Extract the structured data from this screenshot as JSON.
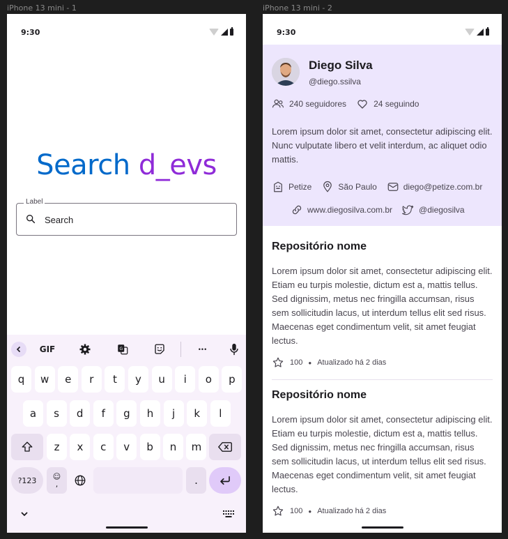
{
  "frames": {
    "frame1_label": "iPhone 13 mini - 1",
    "frame2_label": "iPhone 13 mini - 2"
  },
  "status": {
    "time": "9:30"
  },
  "search_screen": {
    "title_part1": "Search",
    "title_part2": "d_evs",
    "field_label": "Label",
    "field_placeholder": "Search"
  },
  "keyboard": {
    "gif_label": "GIF",
    "row1": [
      "q",
      "w",
      "e",
      "r",
      "t",
      "y",
      "u",
      "i",
      "o",
      "p"
    ],
    "row2": [
      "a",
      "s",
      "d",
      "f",
      "g",
      "h",
      "j",
      "k",
      "l"
    ],
    "row3": [
      "z",
      "x",
      "c",
      "v",
      "b",
      "n",
      "m"
    ],
    "numbers_key": "?123",
    "emoji_comma_top": "☺",
    "emoji_comma_bottom": ",",
    "period_key": ".",
    "toolbar_more": "•••"
  },
  "profile": {
    "name": "Diego Silva",
    "handle": "@diego.ssilva",
    "followers": "240 seguidores",
    "following": "24 seguindo",
    "bio": "Lorem ipsum dolor sit amet, consectetur adipiscing elit. Nunc vulputate libero et velit interdum, ac aliquet odio mattis.",
    "company": "Petize",
    "location": "São Paulo",
    "email": "diego@petize.com.br",
    "website": "www.diegosilva.com.br",
    "twitter": "@diegosilva"
  },
  "repositories": [
    {
      "title": "Repositório nome",
      "description": "Lorem ipsum dolor sit amet, consectetur adipiscing elit. Etiam eu turpis molestie, dictum est a, mattis tellus. Sed dignissim, metus nec fringilla accumsan, risus sem sollicitudin lacus, ut interdum tellus elit sed risus. Maecenas eget condimentum velit, sit amet feugiat lectus.",
      "stars": "100",
      "updated": "Atualizado há 2 dias"
    },
    {
      "title": "Repositório nome",
      "description": "Lorem ipsum dolor sit amet, consectetur adipiscing elit. Etiam eu turpis molestie, dictum est a, mattis tellus. Sed dignissim, metus nec fringilla accumsan, risus sem sollicitudin lacus, ut interdum tellus elit sed risus. Maecenas eget condimentum velit, sit amet feugiat lectus.",
      "stars": "100",
      "updated": "Atualizado há 2 dias"
    }
  ],
  "colors": {
    "title_blue": "#0069ca",
    "title_purple": "#8f2bd8",
    "profile_bg": "#ede6fd",
    "keyboard_bg": "#f8f1fb",
    "enter_key": "#e0caf9"
  }
}
